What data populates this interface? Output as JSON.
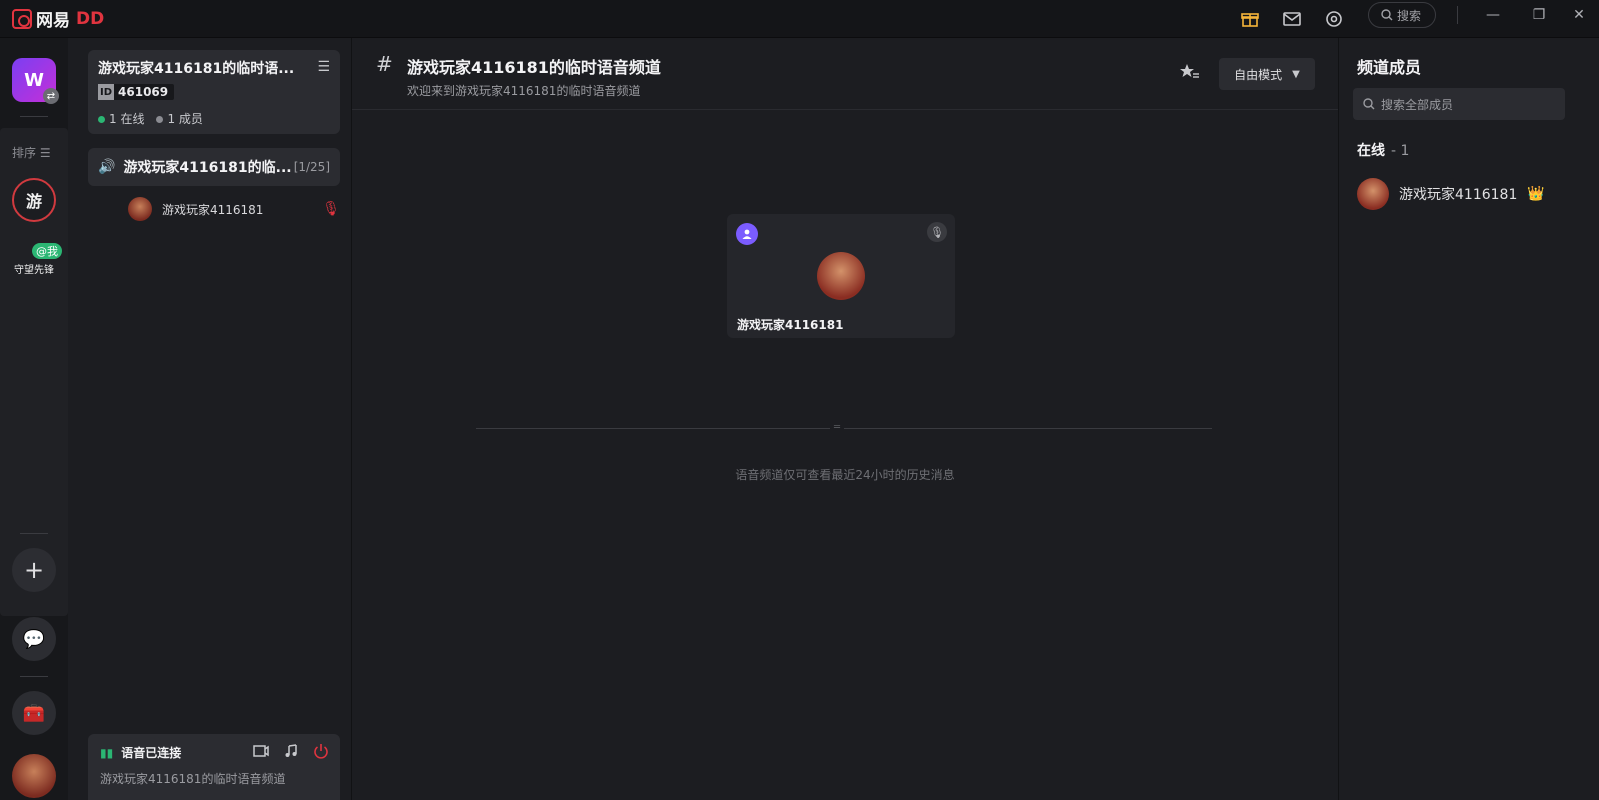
{
  "app": {
    "brand": "网易",
    "brand_accent": "DD"
  },
  "titlebar": {
    "search_label": "搜索",
    "icons": [
      "gift-icon",
      "mail-icon",
      "settings-icon",
      "search-icon",
      "minimize-icon",
      "restore-icon",
      "close-icon"
    ]
  },
  "rail": {
    "sort_label": "排序",
    "you_label": "游",
    "at_me_badge": "@我",
    "ow_caption": "守望先锋"
  },
  "guild": {
    "name": "游戏玩家4116181的临时语...",
    "id_tag": "ID",
    "id": "461069",
    "online": "1 在线",
    "members": "1 成员"
  },
  "channel_list": {
    "voice_channel_name": "游戏玩家4116181的临...",
    "voice_channel_count": "[1/25]",
    "voice_user": "游戏玩家4116181"
  },
  "voice_status": {
    "title": "语音已连接",
    "channel": "游戏玩家4116181的临时语音频道"
  },
  "main": {
    "title": "游戏玩家4116181的临时语音频道",
    "subtitle": "欢迎来到游戏玩家4116181的临时语音频道",
    "mode_label": "自由模式",
    "card_user": "游戏玩家4116181",
    "history_note": "语音频道仅可查看最近24小时的历史消息"
  },
  "members": {
    "title": "频道成员",
    "search_placeholder": "搜索全部成员",
    "online_label": "在线",
    "online_count": "- 1",
    "member_name": "游戏玩家4116181"
  },
  "colors": {
    "accent_red": "#e0343f",
    "online_green": "#2bb673",
    "purple_badge": "#7b5cff",
    "gift_gold": "#f5b43a"
  }
}
